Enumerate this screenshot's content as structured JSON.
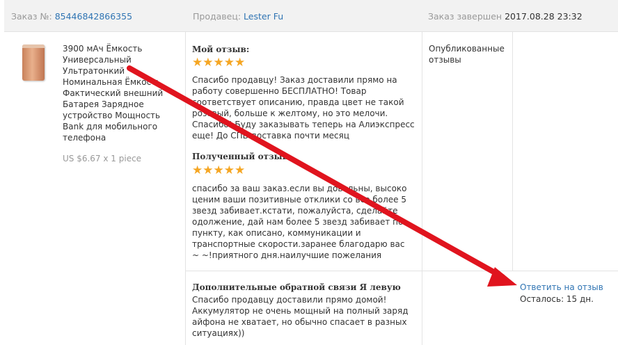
{
  "header": {
    "order_label": "Заказ №:",
    "order_number": "85446842866355",
    "seller_label": "Продавец:",
    "seller_name": "Lester Fu",
    "completed_label": "Заказ завершен",
    "completed_time": "2017.08.28 23:32"
  },
  "product": {
    "title": "3900 мАч Ёмкость Универсальный Ультратонкий Номинальная Ёмкость Фактический внешний Батарея Зарядное устройство Мощность Bank для мобильного телефона",
    "price": "US $6.67 x 1 piece"
  },
  "my_review": {
    "title": "Мой отзыв:",
    "stars": "★★★★★",
    "rating": 5,
    "text": "Спасибо продавцу! Заказ доставили прямо на работу совершенно БЕСПЛАТНО! Товар соответствует описанию, правда цвет не такой розовый, больше к желтому, но это мелочи. Спасибо! Буду заказывать теперь на Алиэкспресс еще! До СПБ доставка почти месяц"
  },
  "received_review": {
    "title": "Полученный отзыв",
    "stars": "★★★★★",
    "rating": 5,
    "text": "спасибо за ваш заказ.если вы довольны, высоко ценим ваши позитивные отклики со все более 5 звезд забивает.кстати, пожалуйста, сделайте одолжение, дай нам более 5 звезд забивает по пункту, как описано, коммуникации и транспортные скорости.заранее благодарю вас ~ ~!приятного дня.наилучшие пожелания"
  },
  "additional_feedback": {
    "title": "Дополнительные обратной связи Я левую",
    "text": "Спасибо продавцу доставили прямо домой! Аккумулятор не очень мощный на полный заряд айфона не хватает, но обычно спасает в разных ситуациях))"
  },
  "status": {
    "text": "Опубликованные отзывы"
  },
  "actions": {
    "reply_label": "Ответить на отзыв",
    "remaining": "Осталось: 15 дн."
  },
  "colors": {
    "link": "#2f74b3",
    "star": "#f5a623",
    "arrow": "#e0141e"
  }
}
